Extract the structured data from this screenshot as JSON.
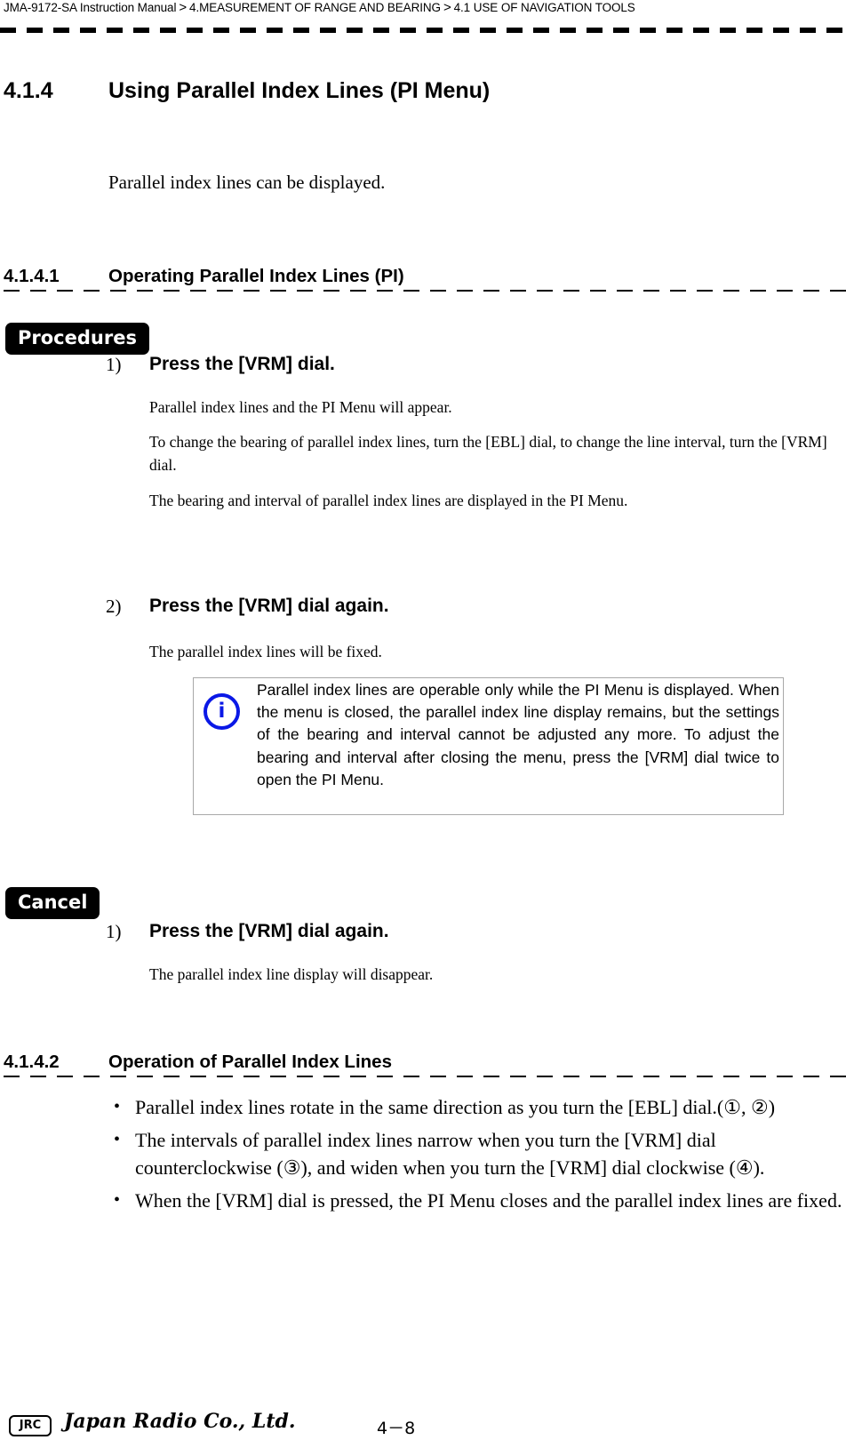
{
  "header": {
    "crumbs": [
      "JMA-9172-SA Instruction Manual",
      "4.MEASUREMENT OF RANGE AND BEARING",
      "4.1  USE OF NAVIGATION TOOLS"
    ],
    "separator": ">"
  },
  "section": {
    "number": "4.1.4",
    "title": "Using Parallel Index Lines (PI Menu)",
    "intro": "Parallel index lines can be displayed."
  },
  "sub1": {
    "number": "4.1.4.1",
    "title": "Operating Parallel Index Lines (PI)",
    "procedures_tag": "Procedures",
    "steps": [
      {
        "num": "1)",
        "title": "Press the [VRM] dial.",
        "paras": [
          "Parallel index lines and the PI Menu will appear.",
          "To change the bearing of parallel index lines, turn the [EBL] dial, to change the line interval, turn the [VRM] dial.",
          "The bearing and interval of parallel index lines are displayed in the PI Menu."
        ]
      },
      {
        "num": "2)",
        "title": "Press the [VRM] dial again.",
        "paras": [
          "The parallel index lines will be fixed."
        ]
      }
    ],
    "info_icon": "info-icon",
    "info_text": "Parallel index lines are operable only while the PI Menu is displayed. When the menu is closed, the parallel index line display remains, but the settings of the bearing and interval cannot be adjusted any more. To adjust the bearing and interval after closing the menu, press the [VRM] dial twice to open the PI Menu.",
    "cancel_tag": "Cancel",
    "cancel_steps": [
      {
        "num": "1)",
        "title": "Press the [VRM] dial again.",
        "paras": [
          "The parallel index line display will disappear."
        ]
      }
    ]
  },
  "sub2": {
    "number": "4.1.4.2",
    "title": "Operation of Parallel Index Lines",
    "bullet": "•",
    "bullets": [
      "Parallel index lines rotate in the same direction as you turn the [EBL] dial.(①, ②)",
      "The intervals of parallel index lines narrow when you turn the [VRM] dial counterclockwise (③), and widen when you turn the [VRM] dial clockwise (④).",
      "When the [VRM] dial is pressed, the PI Menu closes and the parallel index lines are fixed."
    ]
  },
  "footer": {
    "logo": "JRC",
    "company": "Japan Radio Co., Ltd.",
    "page": "4－8"
  }
}
